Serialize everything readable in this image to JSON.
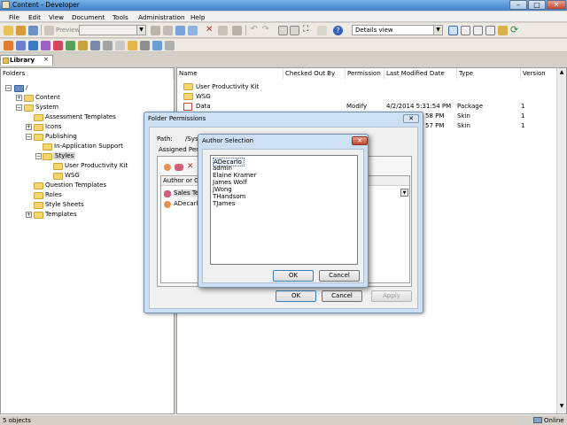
{
  "window": {
    "title": "Content - Developer"
  },
  "menu": [
    "File",
    "Edit",
    "View",
    "Document",
    "Tools",
    "Administration",
    "Help"
  ],
  "toolbar": {
    "preview_label": "Preview",
    "view_combo": "Details view"
  },
  "library": {
    "tab_label": "Library",
    "close": "×"
  },
  "folders_header": "Folders",
  "tree": {
    "root": "/",
    "content": "Content",
    "system": "System",
    "assessment_templates": "Assessment Templates",
    "icons": "Icons",
    "publishing": "Publishing",
    "in_app_support": "In-Application Support",
    "styles": "Styles",
    "upk": "User Productivity Kit",
    "wsg": "WSG",
    "question_templates": "Question Templates",
    "roles": "Roles",
    "style_sheets": "Style Sheets",
    "templates": "Templates"
  },
  "list": {
    "columns": [
      "Name",
      "Checked Out By",
      "Permission",
      "Last Modified Date",
      "Type",
      "Version"
    ],
    "rows": [
      {
        "name": "User Productivity Kit",
        "checked": "",
        "perm": "",
        "date": "",
        "type": "",
        "ver": ""
      },
      {
        "name": "WSG",
        "checked": "",
        "perm": "",
        "date": "",
        "type": "",
        "ver": ""
      },
      {
        "name": "Data",
        "checked": "",
        "perm": "Modify",
        "date": "4/2/2014 5:31:54 PM",
        "type": "Package",
        "ver": "1"
      },
      {
        "name": "",
        "checked": "",
        "perm": "",
        "date": "58 PM",
        "type": "Skin",
        "ver": "1"
      },
      {
        "name": "",
        "checked": "",
        "perm": "",
        "date": "57 PM",
        "type": "Skin",
        "ver": "1"
      }
    ]
  },
  "status": {
    "left": "5 objects",
    "right": "Online"
  },
  "folder_permissions": {
    "title": "Folder Permissions",
    "path_label": "Path:",
    "path_value": "/Syst",
    "assigned_label": "Assigned Perm",
    "grid_header": "Author or Grou",
    "rows": [
      "Sales Team",
      "ADecarlo"
    ],
    "ok": "OK",
    "cancel": "Cancel",
    "apply": "Apply"
  },
  "author_selection": {
    "title": "Author Selection",
    "items": [
      "ADecarlo",
      "admin",
      "Elaine Kramer",
      "James Wolf",
      "JWong",
      "THandsom",
      "TJames"
    ],
    "ok": "OK",
    "cancel": "Cancel"
  }
}
